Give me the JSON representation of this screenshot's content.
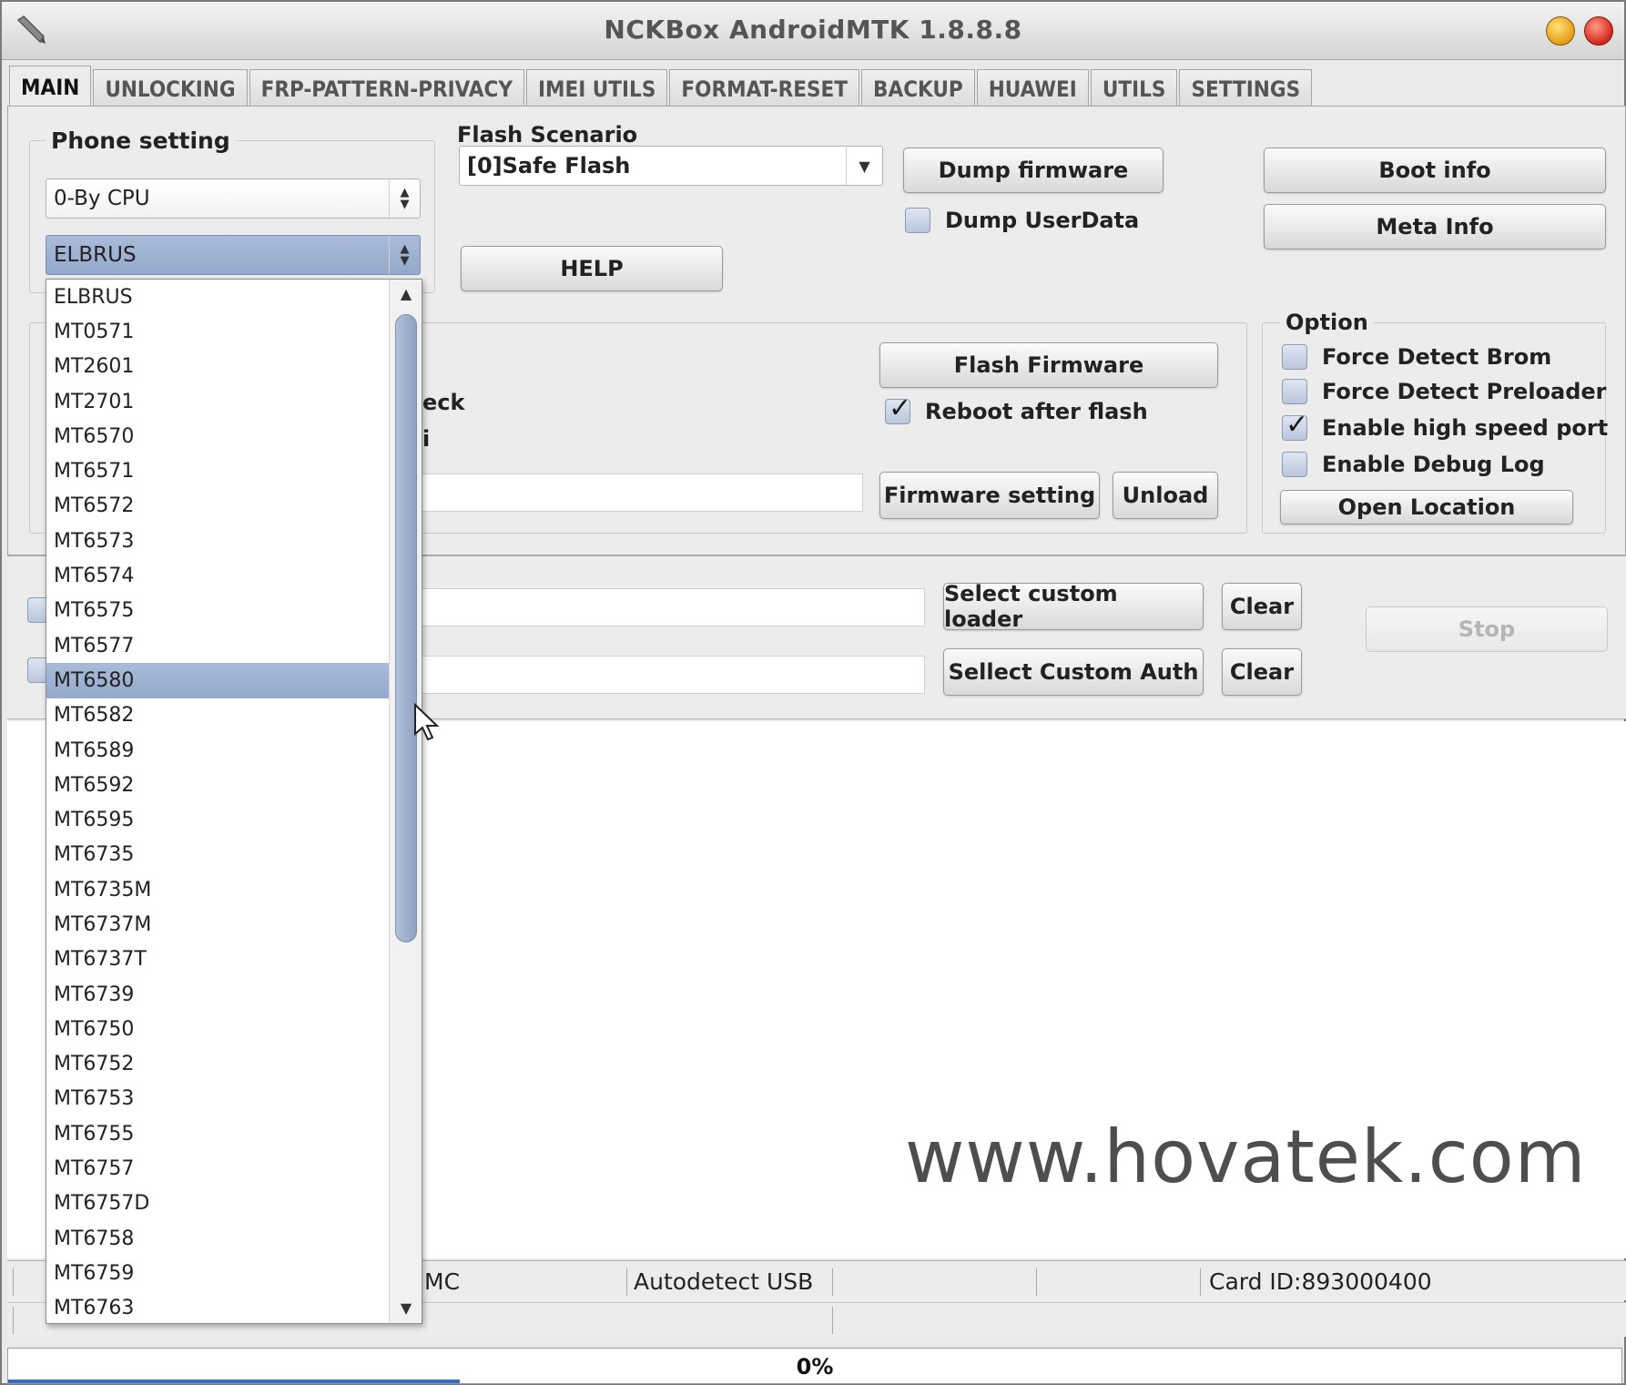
{
  "window": {
    "title": "NCKBox AndroidMTK 1.8.8.8"
  },
  "tabs": [
    "MAIN",
    "UNLOCKING",
    "FRP-PATTERN-PRIVACY",
    "IMEI UTILS",
    "FORMAT-RESET",
    "BACKUP",
    "HUAWEI",
    "UTILS",
    "SETTINGS"
  ],
  "phone_setting": {
    "title": "Phone setting",
    "mode_value": "0-By CPU",
    "cpu_value": "ELBRUS"
  },
  "flash": {
    "scenario_label": "Flash Scenario",
    "scenario_value": "[0]Safe Flash",
    "dump_firmware": "Dump firmware",
    "dump_userdata": "Dump UserData",
    "help": "HELP",
    "flash_firmware": "Flash Firmware",
    "reboot_after_flash": "Reboot after flash",
    "firmware_setting": "Firmware setting",
    "unload": "Unload",
    "partial_check": "eck",
    "partial_i": "i"
  },
  "info": {
    "boot_info": "Boot info",
    "meta_info": "Meta Info"
  },
  "option": {
    "title": "Option",
    "force_detect_brom": "Force Detect Brom",
    "force_detect_preloader": "Force Detect Preloader",
    "enable_high_speed_port": "Enable high speed port",
    "enable_debug_log": "Enable Debug Log",
    "open_location": "Open Location"
  },
  "loader": {
    "select_custom_loader": "Select custom loader",
    "select_custom_auth": "Sellect Custom Auth",
    "clear": "Clear",
    "stop": "Stop"
  },
  "cpu_list": {
    "items": [
      "ELBRUS",
      "MT0571",
      "MT2601",
      "MT2701",
      "MT6570",
      "MT6571",
      "MT6572",
      "MT6573",
      "MT6574",
      "MT6575",
      "MT6577",
      "MT6580",
      "MT6582",
      "MT6589",
      "MT6592",
      "MT6595",
      "MT6735",
      "MT6735M",
      "MT6737M",
      "MT6737T",
      "MT6739",
      "MT6750",
      "MT6752",
      "MT6753",
      "MT6755",
      "MT6757",
      "MT6757D",
      "MT6758",
      "MT6759",
      "MT6763"
    ],
    "highlighted": "MT6580"
  },
  "watermark": "www.hovatek.com",
  "status": {
    "partial": "MC",
    "usb": "Autodetect USB",
    "card_id": "Card ID:893000400"
  },
  "progress": {
    "percent_text": "0%",
    "fraction": 0.28
  },
  "icons": {
    "app": "pen-icon",
    "minimize": "minimize-icon",
    "close": "close-icon"
  }
}
